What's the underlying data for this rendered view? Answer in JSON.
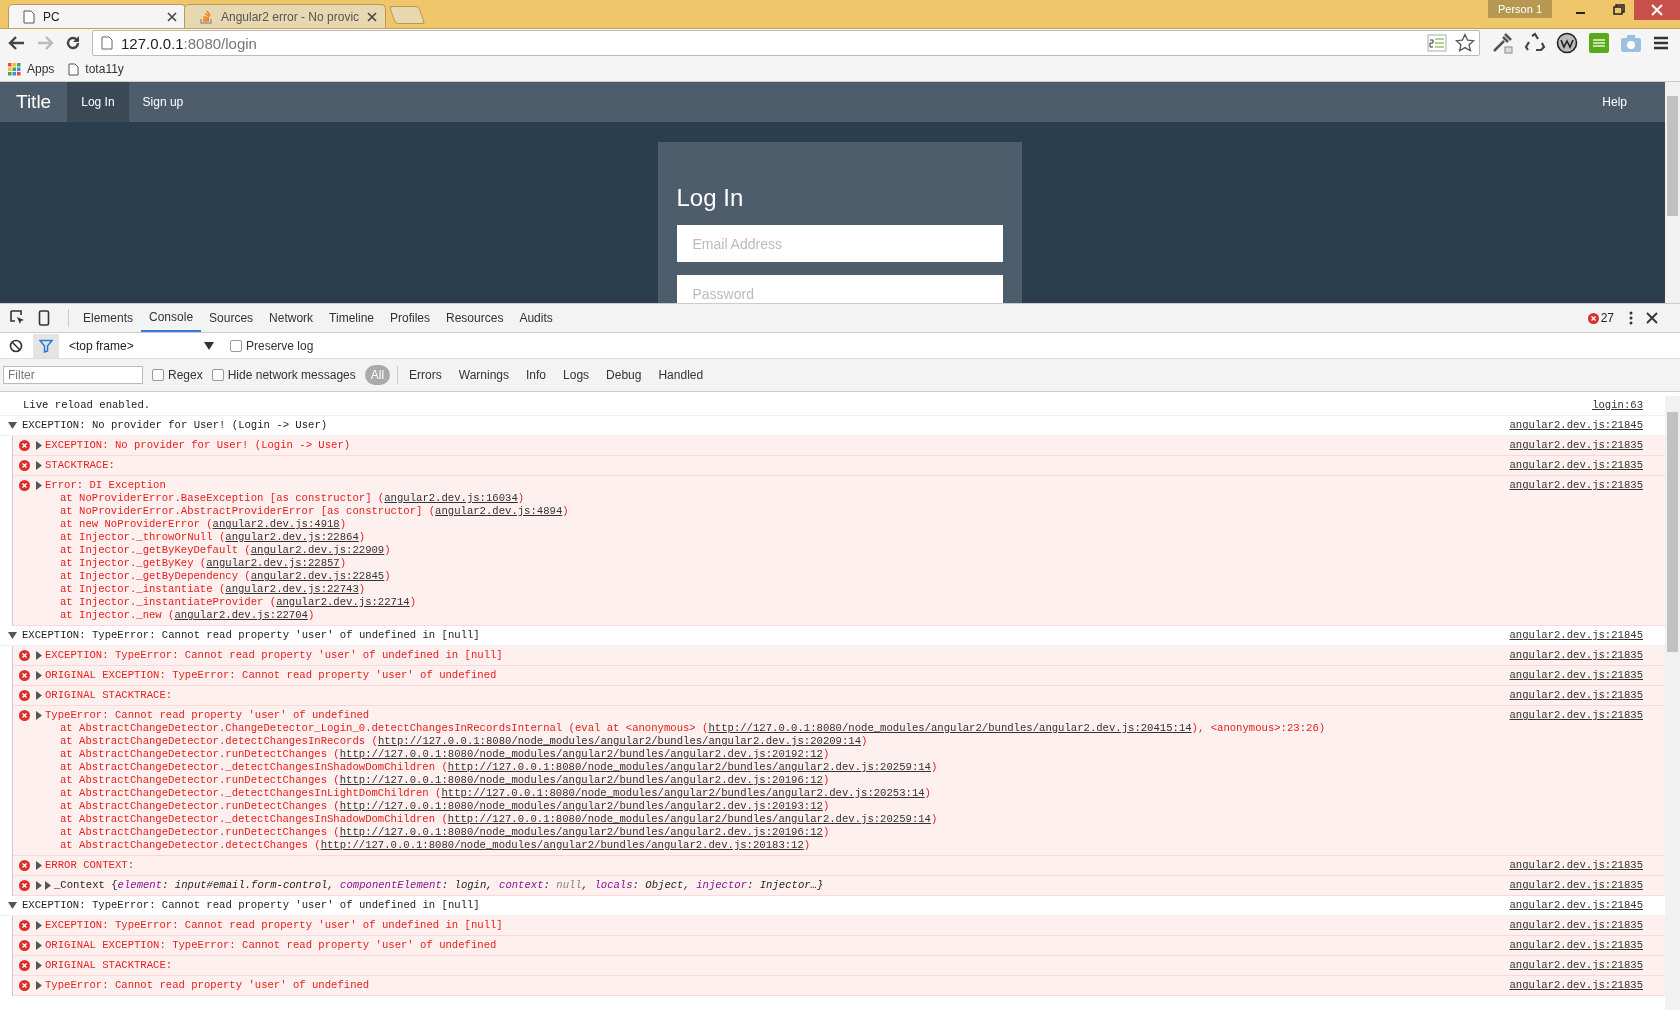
{
  "browser": {
    "tabs": [
      {
        "title": "PC",
        "selected": true
      },
      {
        "title": "Angular2 error - No provic",
        "selected": false
      }
    ],
    "profile": "Person 1",
    "address": {
      "host": "127.0.0.1",
      "rest": ":8080/login"
    },
    "bookmarks": [
      "Apps",
      "tota11y"
    ]
  },
  "page": {
    "brand": "Title",
    "nav": [
      {
        "label": "Log In",
        "selected": true
      },
      {
        "label": "Sign up",
        "selected": false
      }
    ],
    "help": "Help",
    "login": {
      "title": "Log In",
      "fields": [
        {
          "placeholder": "Email Address"
        },
        {
          "placeholder": "Password"
        }
      ]
    }
  },
  "devtools": {
    "tabs": [
      {
        "label": "Elements",
        "selected": false
      },
      {
        "label": "Console",
        "selected": true
      },
      {
        "label": "Sources",
        "selected": false
      },
      {
        "label": "Network",
        "selected": false
      },
      {
        "label": "Timeline",
        "selected": false
      },
      {
        "label": "Profiles",
        "selected": false
      },
      {
        "label": "Resources",
        "selected": false
      },
      {
        "label": "Audits",
        "selected": false
      }
    ],
    "error_count": "27",
    "context": "<top frame>",
    "preserve_log": {
      "label": "Preserve log",
      "checked": false
    },
    "filter": {
      "placeholder": "Filter"
    },
    "regex": {
      "label": "Regex",
      "checked": false
    },
    "hide_network": {
      "label": "Hide network messages",
      "checked": false
    },
    "levels": [
      {
        "label": "All",
        "selected": true
      },
      {
        "label": "Errors",
        "selected": false
      },
      {
        "label": "Warnings",
        "selected": false
      },
      {
        "label": "Info",
        "selected": false
      },
      {
        "label": "Logs",
        "selected": false
      },
      {
        "label": "Debug",
        "selected": false
      },
      {
        "label": "Handled",
        "selected": false
      }
    ]
  },
  "console": {
    "messages": [
      {
        "kind": "log",
        "text": "Live reload enabled.",
        "source": "login:63"
      },
      {
        "kind": "group",
        "text": "EXCEPTION: No provider for User! (Login -> User)",
        "source": "angular2.dev.js:21845",
        "expanded": true,
        "children": [
          {
            "kind": "error",
            "text": "EXCEPTION: No provider for User! (Login -> User)",
            "source": "angular2.dev.js:21835",
            "expanded": false
          },
          {
            "kind": "error",
            "text": "STACKTRACE:",
            "source": "angular2.dev.js:21835",
            "expanded": false
          },
          {
            "kind": "error",
            "text": "Error: DI Exception",
            "source": "angular2.dev.js:21835",
            "expanded": false,
            "trace": [
              {
                "text": "at NoProviderError.BaseException [as constructor] (",
                "link": "angular2.dev.js:16034",
                "tail": ")"
              },
              {
                "text": "at NoProviderError.AbstractProviderError [as constructor] (",
                "link": "angular2.dev.js:4894",
                "tail": ")"
              },
              {
                "text": "at new NoProviderError (",
                "link": "angular2.dev.js:4918",
                "tail": ")"
              },
              {
                "text": "at Injector._throwOrNull (",
                "link": "angular2.dev.js:22864",
                "tail": ")"
              },
              {
                "text": "at Injector._getByKeyDefault (",
                "link": "angular2.dev.js:22909",
                "tail": ")"
              },
              {
                "text": "at Injector._getByKey (",
                "link": "angular2.dev.js:22857",
                "tail": ")"
              },
              {
                "text": "at Injector._getByDependency (",
                "link": "angular2.dev.js:22845",
                "tail": ")"
              },
              {
                "text": "at Injector._instantiate (",
                "link": "angular2.dev.js:22743",
                "tail": ")"
              },
              {
                "text": "at Injector._instantiateProvider (",
                "link": "angular2.dev.js:22714",
                "tail": ")"
              },
              {
                "text": "at Injector._new (",
                "link": "angular2.dev.js:22704",
                "tail": ")"
              }
            ]
          }
        ]
      },
      {
        "kind": "group",
        "text": "EXCEPTION: TypeError: Cannot read property 'user' of undefined in [null]",
        "source": "angular2.dev.js:21845",
        "expanded": true,
        "children": [
          {
            "kind": "error",
            "text": "EXCEPTION: TypeError: Cannot read property 'user' of undefined in [null]",
            "source": "angular2.dev.js:21835",
            "expanded": false
          },
          {
            "kind": "error",
            "text": "ORIGINAL EXCEPTION: TypeError: Cannot read property 'user' of undefined",
            "source": "angular2.dev.js:21835",
            "expanded": false
          },
          {
            "kind": "error",
            "text": "ORIGINAL STACKTRACE:",
            "source": "angular2.dev.js:21835",
            "expanded": false
          },
          {
            "kind": "error",
            "text": "TypeError: Cannot read property 'user' of undefined",
            "source": "angular2.dev.js:21835",
            "expanded": false,
            "trace": [
              {
                "text": "at AbstractChangeDetector.ChangeDetector_Login_0.detectChangesInRecordsInternal (eval at <anonymous> (",
                "link": "http://127.0.0.1:8080/node_modules/angular2/bundles/angular2.dev.js:20415:14",
                "tail": "), <anonymous>:23:26)"
              },
              {
                "text": "at AbstractChangeDetector.detectChangesInRecords (",
                "link": "http://127.0.0.1:8080/node_modules/angular2/bundles/angular2.dev.js:20209:14",
                "tail": ")"
              },
              {
                "text": "at AbstractChangeDetector.runDetectChanges (",
                "link": "http://127.0.0.1:8080/node_modules/angular2/bundles/angular2.dev.js:20192:12",
                "tail": ")"
              },
              {
                "text": "at AbstractChangeDetector._detectChangesInShadowDomChildren (",
                "link": "http://127.0.0.1:8080/node_modules/angular2/bundles/angular2.dev.js:20259:14",
                "tail": ")"
              },
              {
                "text": "at AbstractChangeDetector.runDetectChanges (",
                "link": "http://127.0.0.1:8080/node_modules/angular2/bundles/angular2.dev.js:20196:12",
                "tail": ")"
              },
              {
                "text": "at AbstractChangeDetector._detectChangesInLightDomChildren (",
                "link": "http://127.0.0.1:8080/node_modules/angular2/bundles/angular2.dev.js:20253:14",
                "tail": ")"
              },
              {
                "text": "at AbstractChangeDetector.runDetectChanges (",
                "link": "http://127.0.0.1:8080/node_modules/angular2/bundles/angular2.dev.js:20193:12",
                "tail": ")"
              },
              {
                "text": "at AbstractChangeDetector._detectChangesInShadowDomChildren (",
                "link": "http://127.0.0.1:8080/node_modules/angular2/bundles/angular2.dev.js:20259:14",
                "tail": ")"
              },
              {
                "text": "at AbstractChangeDetector.runDetectChanges (",
                "link": "http://127.0.0.1:8080/node_modules/angular2/bundles/angular2.dev.js:20196:12",
                "tail": ")"
              },
              {
                "text": "at AbstractChangeDetector.detectChanges (",
                "link": "http://127.0.0.1:8080/node_modules/angular2/bundles/angular2.dev.js:20183:12",
                "tail": ")"
              }
            ]
          },
          {
            "kind": "error",
            "text": "ERROR CONTEXT:",
            "source": "angular2.dev.js:21835",
            "expanded": false
          },
          {
            "kind": "object",
            "source": "angular2.dev.js:21835",
            "expanded": false,
            "segments": [
              {
                "text": "_Context {",
                "kind": "name"
              },
              {
                "text": "element",
                "kind": "key"
              },
              {
                "text": ": input#email.form-control, ",
                "kind": "value"
              },
              {
                "text": "componentElement",
                "kind": "key"
              },
              {
                "text": ": login, ",
                "kind": "value"
              },
              {
                "text": "context",
                "kind": "key"
              },
              {
                "text": ": ",
                "kind": "value"
              },
              {
                "text": "null",
                "kind": "null"
              },
              {
                "text": ", ",
                "kind": "value"
              },
              {
                "text": "locals",
                "kind": "key"
              },
              {
                "text": ": Object, ",
                "kind": "value"
              },
              {
                "text": "injector",
                "kind": "key"
              },
              {
                "text": ": Injector…}",
                "kind": "value"
              }
            ]
          }
        ]
      },
      {
        "kind": "group",
        "text": "EXCEPTION: TypeError: Cannot read property 'user' of undefined in [null]",
        "source": "angular2.dev.js:21845",
        "expanded": true,
        "children": [
          {
            "kind": "error",
            "text": "EXCEPTION: TypeError: Cannot read property 'user' of undefined in [null]",
            "source": "angular2.dev.js:21835",
            "expanded": false
          },
          {
            "kind": "error",
            "text": "ORIGINAL EXCEPTION: TypeError: Cannot read property 'user' of undefined",
            "source": "angular2.dev.js:21835",
            "expanded": false
          },
          {
            "kind": "error",
            "text": "ORIGINAL STACKTRACE:",
            "source": "angular2.dev.js:21835",
            "expanded": false
          },
          {
            "kind": "error",
            "text": "TypeError: Cannot read property 'user' of undefined",
            "source": "angular2.dev.js:21835",
            "expanded": false
          }
        ]
      }
    ]
  }
}
